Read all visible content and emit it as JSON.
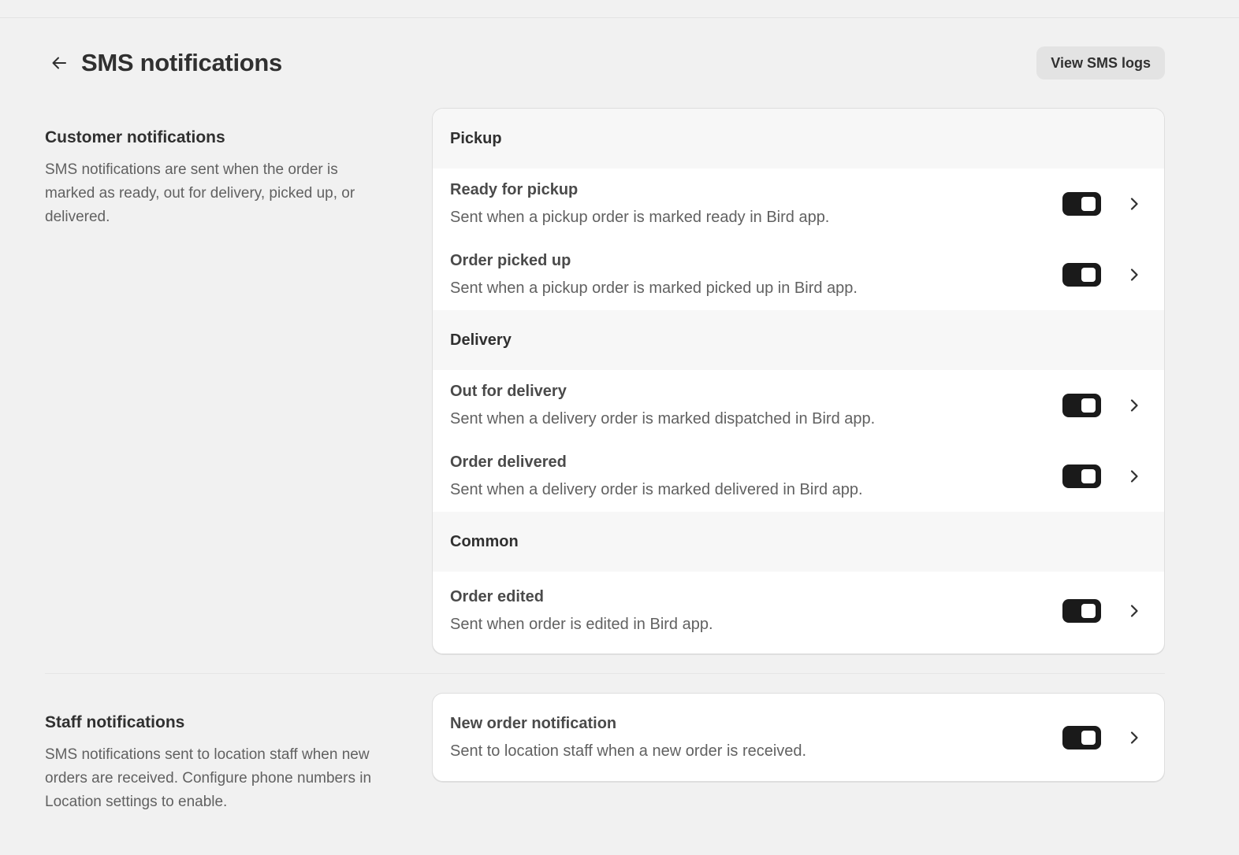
{
  "header": {
    "title": "SMS notifications",
    "logs_button": "View SMS logs"
  },
  "customer": {
    "title": "Customer notifications",
    "description": "SMS notifications are sent when the order is marked as ready, out for delivery, picked up, or delivered.",
    "groups": [
      {
        "label": "Pickup",
        "items": [
          {
            "title": "Ready for pickup",
            "desc": "Sent when a pickup order is marked ready in Bird app.",
            "enabled": true
          },
          {
            "title": "Order picked up",
            "desc": "Sent when a pickup order is marked picked up in Bird app.",
            "enabled": true
          }
        ]
      },
      {
        "label": "Delivery",
        "items": [
          {
            "title": "Out for delivery",
            "desc": "Sent when a delivery order is marked dispatched in Bird app.",
            "enabled": true
          },
          {
            "title": "Order delivered",
            "desc": "Sent when a delivery order is marked delivered in Bird app.",
            "enabled": true
          }
        ]
      },
      {
        "label": "Common",
        "items": [
          {
            "title": "Order edited",
            "desc": "Sent when order is edited in Bird app.",
            "enabled": true
          }
        ]
      }
    ]
  },
  "staff": {
    "title": "Staff notifications",
    "description": "SMS notifications sent to location staff when new orders are received. Configure phone numbers in Location settings to enable.",
    "items": [
      {
        "title": "New order notification",
        "desc": "Sent to location staff when a new order is received.",
        "enabled": true
      }
    ]
  }
}
